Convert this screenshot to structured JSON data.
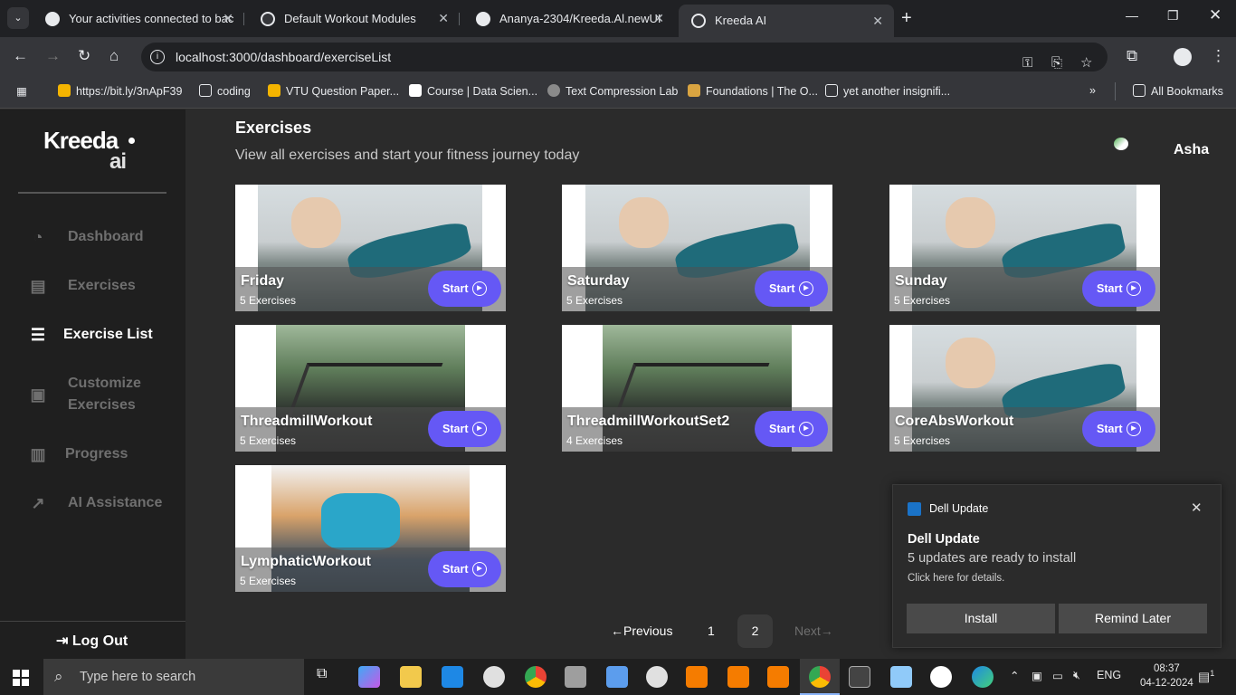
{
  "browser": {
    "tabs": [
      {
        "title": "Your activities connected to bac",
        "favicon": "github-icon"
      },
      {
        "title": "Default Workout Modules",
        "favicon": "notion-icon"
      },
      {
        "title": "Ananya-2304/Kreeda.Al.newUI",
        "favicon": "github-icon"
      },
      {
        "title": "Kreeda AI",
        "favicon": "react-icon"
      }
    ],
    "url": "localhost:3000/dashboard/exerciseList",
    "bookmarks": [
      "https://bit.ly/3nApF39",
      "coding",
      "VTU Question Paper...",
      "Course | Data Scien...",
      "Text Compression Lab",
      "Foundations | The O...",
      "yet another insignifi..."
    ],
    "all_bookmarks": "All Bookmarks"
  },
  "sidebar": {
    "logo_main": "Kreeda",
    "logo_sub": "ai",
    "items": [
      {
        "label": "Dashboard",
        "icon": "pie-chart-icon"
      },
      {
        "label": "Exercises",
        "icon": "clipboard-icon"
      },
      {
        "label": "Exercise List",
        "icon": "list-icon"
      },
      {
        "label": "Customize",
        "label2": "Exercises",
        "icon": "calendar-icon"
      },
      {
        "label": "Progress",
        "icon": "map-icon"
      },
      {
        "label": "AI Assistance",
        "icon": "trending-up-icon"
      }
    ],
    "logout": "Log Out"
  },
  "main": {
    "title": "Exercises",
    "subtitle": "View all exercises and start your fitness journey today",
    "user_name": "Asha",
    "start_label": "Start",
    "cards": [
      {
        "name": "Friday",
        "count": "5 Exercises",
        "image": "sit-up"
      },
      {
        "name": "Saturday",
        "count": "5 Exercises",
        "image": "sit-up"
      },
      {
        "name": "Sunday",
        "count": "5 Exercises",
        "image": "sit-up"
      },
      {
        "name": "ThreadmillWorkout",
        "count": "5 Exercises",
        "image": "treadmill"
      },
      {
        "name": "ThreadmillWorkoutSet2",
        "count": "4 Exercises",
        "image": "treadmill"
      },
      {
        "name": "CoreAbsWorkout",
        "count": "5 Exercises",
        "image": "sit-up"
      },
      {
        "name": "LymphaticWorkout",
        "count": "5 Exercises",
        "image": "plank"
      }
    ],
    "pagination": {
      "previous": "Previous",
      "pages": [
        "1",
        "2"
      ],
      "current": "2",
      "next": "Next"
    }
  },
  "toast": {
    "app": "Dell Update",
    "title": "Dell Update",
    "message": "5 updates are ready to install",
    "hint": "Click here for details.",
    "install": "Install",
    "remind": "Remind Later"
  },
  "taskbar": {
    "search_placeholder": "Type here to search",
    "language": "ENG",
    "time": "08:37",
    "date": "04-12-2024",
    "notifications": "1"
  }
}
